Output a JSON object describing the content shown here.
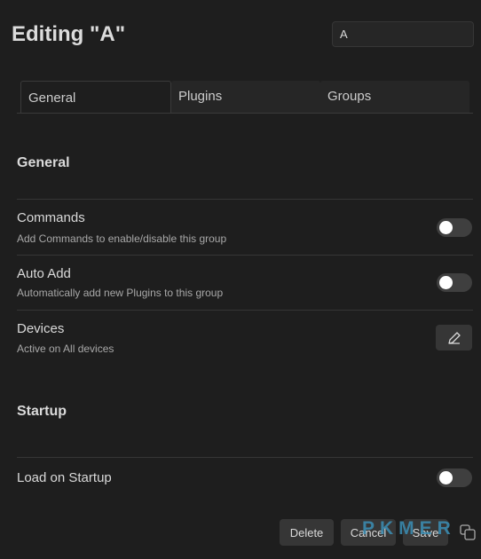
{
  "header": {
    "title": "Editing \"A\"",
    "name_value": "A"
  },
  "tabs": [
    {
      "label": "General",
      "active": true
    },
    {
      "label": "Plugins",
      "active": false
    },
    {
      "label": "Groups",
      "active": false
    }
  ],
  "general": {
    "heading": "General",
    "commands": {
      "name": "Commands",
      "desc": "Add Commands to enable/disable this group",
      "enabled": false
    },
    "auto_add": {
      "name": "Auto Add",
      "desc": "Automatically add new Plugins to this group",
      "enabled": false
    },
    "devices": {
      "name": "Devices",
      "desc": "Active on All devices",
      "icon": "pencil-icon"
    }
  },
  "startup": {
    "heading": "Startup",
    "load": {
      "name": "Load on Startup",
      "enabled": false
    }
  },
  "footer": {
    "delete": "Delete",
    "cancel": "Cancel",
    "save": "Save",
    "copy_icon": "copy-icon"
  },
  "watermark": "PKMER"
}
